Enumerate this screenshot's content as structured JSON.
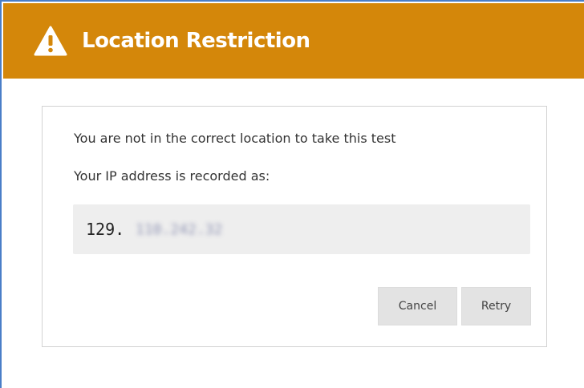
{
  "dialog": {
    "title": "Location Restriction",
    "header_color": "#d4870a",
    "icon": "warning-icon"
  },
  "message": {
    "line1": "You are not in the correct location to take this test",
    "line2": "Your IP address is recorded as:"
  },
  "ip": {
    "visible_prefix": "129.",
    "redacted_part": "110.242.32"
  },
  "buttons": {
    "cancel_label": "Cancel",
    "retry_label": "Retry"
  }
}
